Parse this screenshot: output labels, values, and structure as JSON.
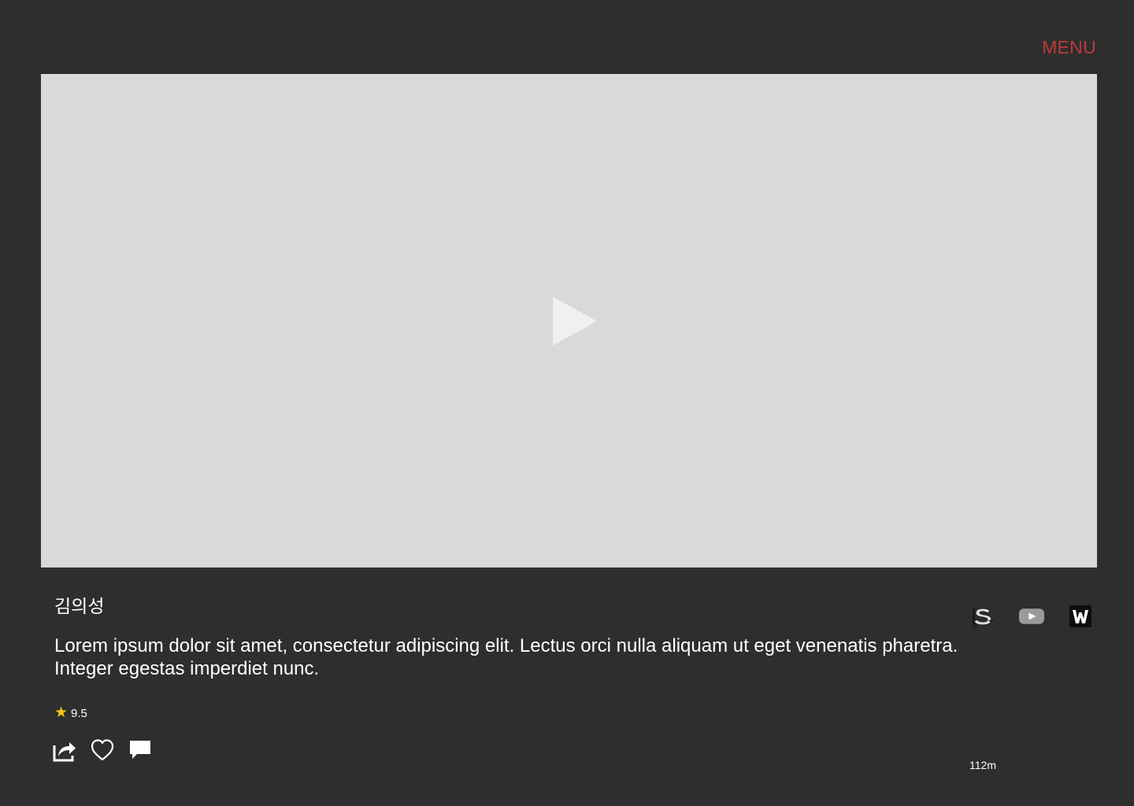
{
  "header": {
    "menu_label": "MENU"
  },
  "colors": {
    "background": "#2e2e2e",
    "accent": "#c0393b",
    "video_placeholder": "#d9d9d9",
    "star": "#f5c518"
  },
  "video": {
    "play_icon": "play-icon"
  },
  "content": {
    "title": "김의성",
    "description": "Lorem ipsum dolor sit amet, consectetur adipiscing elit. Lectus orci nulla aliquam ut eget venenatis pharetra. Integer egestas imperdiet nunc.",
    "rating": "9.5",
    "duration": "112m"
  },
  "actions": [
    {
      "icon": "share-icon"
    },
    {
      "icon": "heart-icon"
    },
    {
      "icon": "comment-icon"
    }
  ],
  "platforms": [
    {
      "icon": "s-logo-icon"
    },
    {
      "icon": "youtube-icon"
    },
    {
      "icon": "w-logo-icon"
    }
  ]
}
